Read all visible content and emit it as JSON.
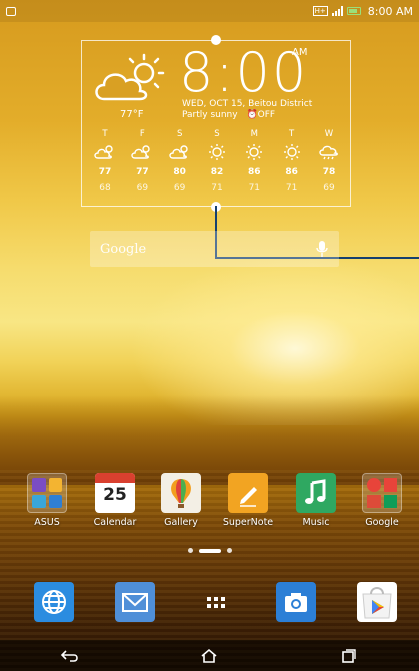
{
  "status_bar": {
    "time": "8:00 AM",
    "sim_label": "H+"
  },
  "widget": {
    "time": "8:00",
    "ampm": "AM",
    "date_location": "WED, OCT 15, Beitou District",
    "condition": "Partly sunny",
    "alarm": "⏰OFF",
    "current_temp": "77°F",
    "forecast": [
      {
        "day": "T",
        "icon": "partly-cloudy-icon",
        "high": "77",
        "low": "68"
      },
      {
        "day": "F",
        "icon": "partly-cloudy-icon",
        "high": "77",
        "low": "69"
      },
      {
        "day": "S",
        "icon": "partly-cloudy-icon",
        "high": "80",
        "low": "69"
      },
      {
        "day": "S",
        "icon": "sun-icon",
        "high": "82",
        "low": "71"
      },
      {
        "day": "M",
        "icon": "sun-icon",
        "high": "86",
        "low": "71"
      },
      {
        "day": "T",
        "icon": "sun-icon",
        "high": "86",
        "low": "71"
      },
      {
        "day": "W",
        "icon": "rain-cloud-icon",
        "high": "78",
        "low": "69"
      }
    ]
  },
  "search": {
    "label": "Google"
  },
  "apps": [
    {
      "label": "ASUS",
      "icon": "asus-folder-icon"
    },
    {
      "label": "Calendar",
      "icon": "calendar-icon",
      "day": "25"
    },
    {
      "label": "Gallery",
      "icon": "gallery-balloon-icon"
    },
    {
      "label": "SuperNote",
      "icon": "supernote-pen-icon"
    },
    {
      "label": "Music",
      "icon": "music-note-icon"
    },
    {
      "label": "Google",
      "icon": "google-folder-icon"
    }
  ],
  "dock": [
    {
      "icon": "browser-globe-icon"
    },
    {
      "icon": "mail-envelope-icon"
    },
    {
      "icon": "all-apps-grid-icon"
    },
    {
      "icon": "camera-icon"
    },
    {
      "icon": "play-store-icon"
    }
  ],
  "navbar": [
    "back-icon",
    "home-icon",
    "recent-apps-icon"
  ]
}
